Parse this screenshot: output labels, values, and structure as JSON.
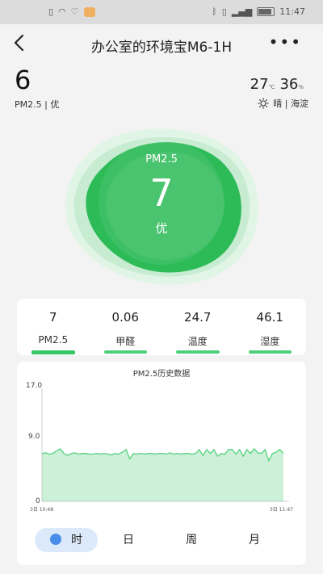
{
  "status_bar": {
    "time": "11:47"
  },
  "header": {
    "title": "办公室的环境宝M6-1H",
    "more_label": "•••"
  },
  "summary": {
    "value": "6",
    "sub": "PM2.5 | 优"
  },
  "weather": {
    "temp": "27",
    "temp_unit": "℃",
    "humidity": "36",
    "humidity_unit": "%",
    "condition": "晴 | 海淀"
  },
  "blob": {
    "label": "PM2.5",
    "value": "7",
    "level": "优",
    "color": "#2dbb58"
  },
  "metrics": [
    {
      "value": "7",
      "label": "PM2.5"
    },
    {
      "value": "0.06",
      "label": "甲醛"
    },
    {
      "value": "24.7",
      "label": "温度"
    },
    {
      "value": "46.1",
      "label": "湿度"
    }
  ],
  "chart_data": {
    "type": "area",
    "title": "PM2.5历史数据",
    "ylim": [
      0,
      17
    ],
    "yticks": [
      "17.0",
      "9.0",
      "0"
    ],
    "x_start_label": "3日 10:48",
    "x_end_label": "3日 11:47",
    "color": "#57d07e",
    "values": [
      7.2,
      7.3,
      7.1,
      7.2,
      7.6,
      7.9,
      7.2,
      6.9,
      7.2,
      7.3,
      7.1,
      7.2,
      7.2,
      7.1,
      7.1,
      7.2,
      7.1,
      7.2,
      7.1,
      7.0,
      7.2,
      7.1,
      7.4,
      7.8,
      6.4,
      7.2,
      7.1,
      7.2,
      7.1,
      7.2,
      7.2,
      7.1,
      7.2,
      7.2,
      7.1,
      7.3,
      7.1,
      7.2,
      7.1,
      7.2,
      7.2,
      7.1,
      7.2,
      7.8,
      6.9,
      7.8,
      7.2,
      7.8,
      6.8,
      7.2,
      7.1,
      7.8,
      7.8,
      7.1,
      7.8,
      6.8,
      7.8,
      7.2,
      7.9,
      7.3,
      7.2,
      7.8,
      6.1,
      7.2,
      7.4,
      7.8,
      7.2
    ]
  },
  "tabs": [
    "时",
    "日",
    "周",
    "月"
  ]
}
